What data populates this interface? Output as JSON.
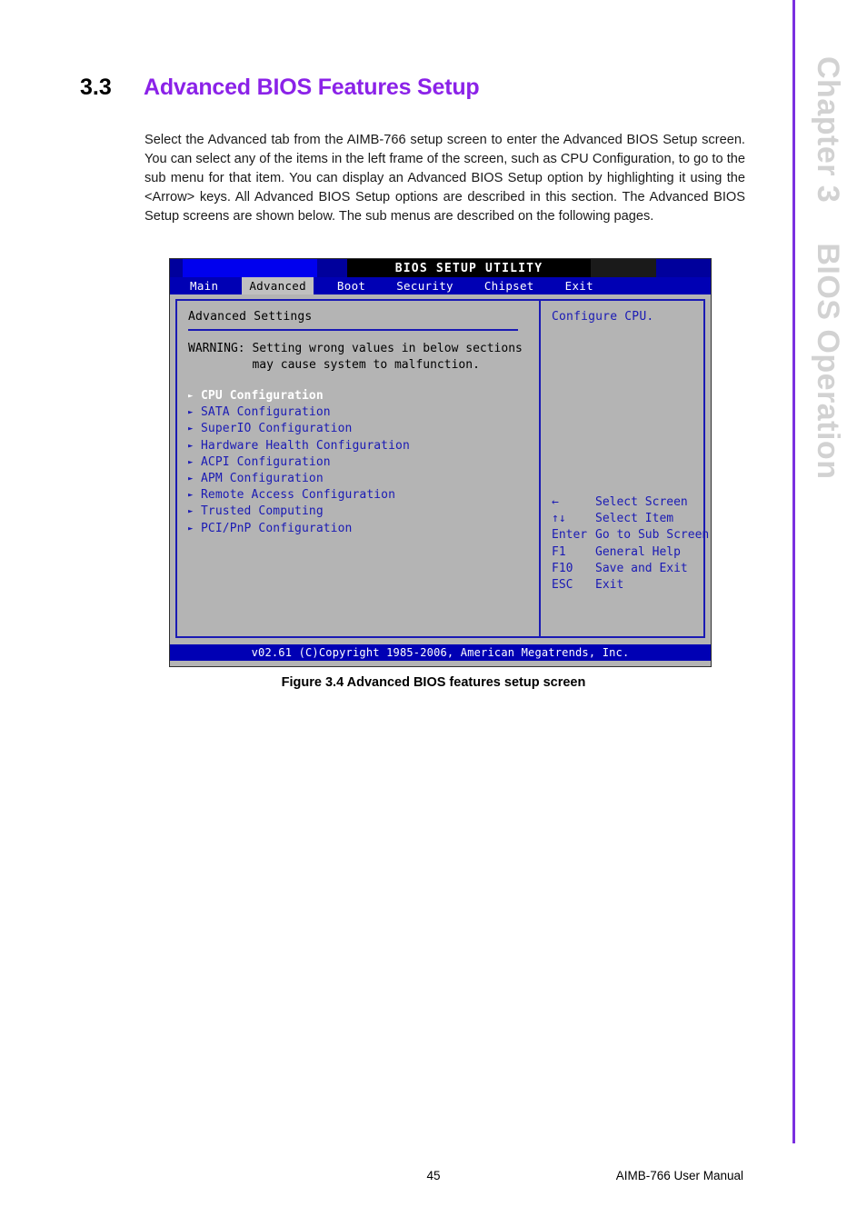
{
  "chapter_rail": {
    "label_part1": "Chapter 3",
    "label_part2": "BIOS Operation",
    "accent_color": "#7B2FE0"
  },
  "section": {
    "number": "3.3",
    "title": "Advanced BIOS Features Setup",
    "title_color": "#8B22E8",
    "paragraph": "Select the Advanced tab from the AIMB-766 setup screen to enter the Advanced BIOS Setup screen. You can select any of the items in the left frame of the screen, such as CPU Configuration, to go to the sub menu for that item. You can display an Advanced BIOS Setup option by highlighting it using the <Arrow> keys. All Advanced BIOS Setup options are described in this section. The Advanced BIOS Setup screens are shown below. The sub menus are described on the following pages."
  },
  "bios": {
    "title": "BIOS SETUP UTILITY",
    "menu_tabs": [
      {
        "label": "Main",
        "active": false
      },
      {
        "label": "Advanced",
        "active": true
      },
      {
        "label": "Boot",
        "active": false
      },
      {
        "label": "Security",
        "active": false
      },
      {
        "label": "Chipset",
        "active": false
      },
      {
        "label": "Exit",
        "active": false
      }
    ],
    "left_panel": {
      "heading": "Advanced Settings",
      "warning_line1": "WARNING: Setting wrong values in below sections",
      "warning_line2": "         may cause system to malfunction.",
      "items": [
        {
          "label": "CPU Configuration",
          "selected": true
        },
        {
          "label": "SATA Configuration",
          "selected": false
        },
        {
          "label": "SuperIO Configuration",
          "selected": false
        },
        {
          "label": "Hardware Health Configuration",
          "selected": false
        },
        {
          "label": "ACPI Configuration",
          "selected": false
        },
        {
          "label": "APM Configuration",
          "selected": false
        },
        {
          "label": "Remote Access Configuration",
          "selected": false
        },
        {
          "label": "Trusted Computing",
          "selected": false
        },
        {
          "label": "PCI/PnP Configuration",
          "selected": false
        }
      ]
    },
    "right_panel": {
      "help_text": "Configure CPU.",
      "keys": [
        {
          "key": "←",
          "desc": "Select Screen"
        },
        {
          "key": "↑↓",
          "desc": "Select Item"
        },
        {
          "key": "Enter",
          "desc": "Go to Sub Screen"
        },
        {
          "key": "F1",
          "desc": "General Help"
        },
        {
          "key": "F10",
          "desc": "Save and Exit"
        },
        {
          "key": "ESC",
          "desc": "Exit"
        }
      ]
    },
    "footer": "v02.61 (C)Copyright 1985-2006, American Megatrends, Inc."
  },
  "figure": {
    "caption": "Figure 3.4 Advanced BIOS features setup screen"
  },
  "page_footer": {
    "page_number": "45",
    "manual_title": "AIMB-766 User Manual"
  }
}
